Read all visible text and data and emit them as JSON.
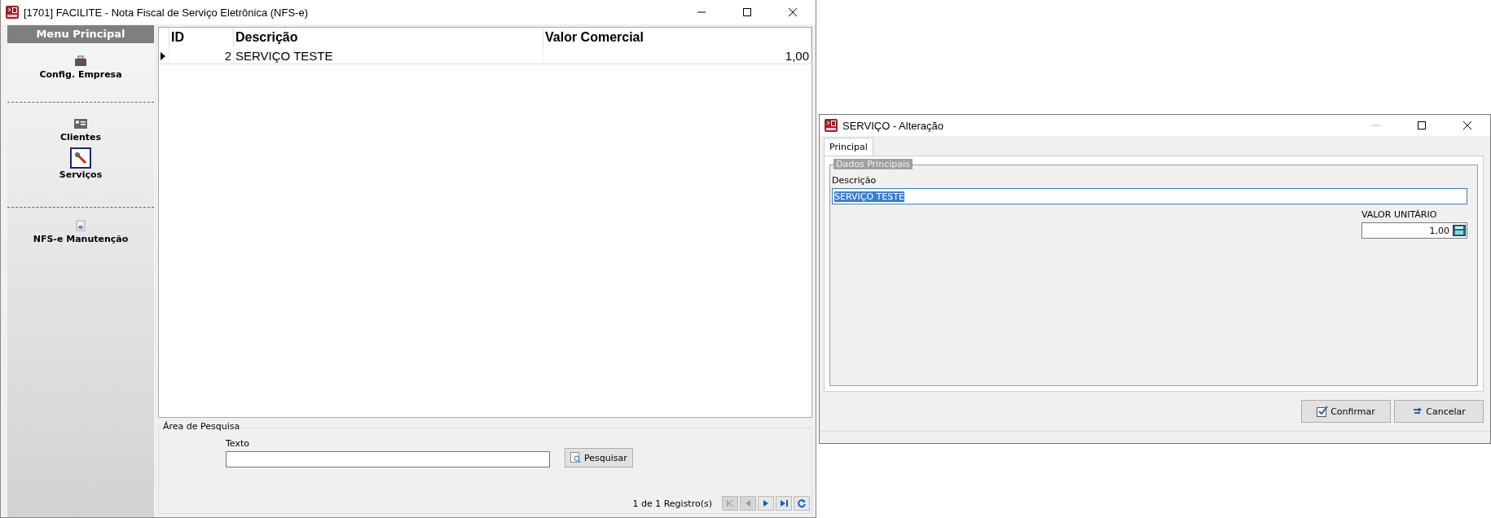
{
  "main_window": {
    "title": "[1701] FACILITE - Nota Fiscal de Serviço Eletrônica (NFS-e)"
  },
  "sidebar": {
    "header": "Menu Principal",
    "groups": [
      {
        "items": [
          {
            "label": "Config. Empresa",
            "kind": "briefcase",
            "selected": false
          }
        ]
      },
      {
        "items": [
          {
            "label": "Clientes",
            "kind": "card",
            "selected": false
          },
          {
            "label": "Serviços",
            "kind": "wrench",
            "selected": true
          }
        ]
      },
      {
        "items": [
          {
            "label": "NFS-e Manutenção",
            "kind": "document",
            "selected": false
          }
        ]
      }
    ]
  },
  "table": {
    "columns": [
      "ID",
      "Descrição",
      "Valor Comercial"
    ],
    "rows": [
      {
        "cells": [
          "2",
          "SERVIÇO TESTE",
          "1,00"
        ],
        "selected": true
      }
    ]
  },
  "search_area": {
    "title": "Área de Pesquisa",
    "label": "Texto",
    "button": "Pesquisar",
    "count": "1 de 1 Registro(s)",
    "nav": [
      {
        "kind": "first",
        "disabled": true
      },
      {
        "kind": "prev",
        "disabled": true
      },
      {
        "kind": "next",
        "disabled": false
      },
      {
        "kind": "last",
        "disabled": false
      },
      {
        "kind": "refresh",
        "disabled": false
      }
    ]
  },
  "dialog": {
    "title": "SERVIÇO - Alteração",
    "tabs": [
      {
        "label": "Principal",
        "selected": true
      }
    ],
    "group_title": "Dados Principais",
    "fields": [
      {
        "label": "Descrição",
        "value": "SERVIÇO TESTE",
        "highlighted": true,
        "kind": "text"
      },
      {
        "label": "VALOR UNITÁRIO",
        "value": "1,00",
        "highlighted": false,
        "kind": "number"
      }
    ],
    "buttons": [
      {
        "label": "Confirmar",
        "kind": "confirm"
      },
      {
        "label": "Cancelar",
        "kind": "cancel"
      }
    ]
  }
}
